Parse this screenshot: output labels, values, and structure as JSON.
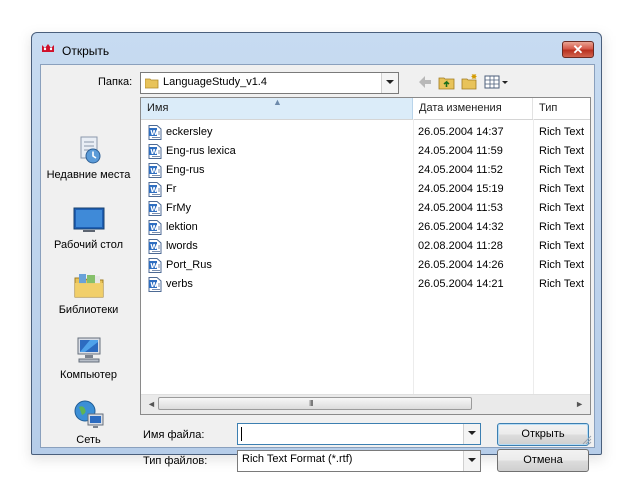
{
  "window": {
    "title": "Открыть",
    "close_glyph": "✕"
  },
  "toolbar": {
    "folder_label": "Папка:",
    "folder_value": "LanguageStudy_v1.4"
  },
  "places": [
    {
      "label": "Недавние места",
      "icon": "recent-places-icon"
    },
    {
      "label": "Рабочий стол",
      "icon": "desktop-icon"
    },
    {
      "label": "Библиотеки",
      "icon": "libraries-icon"
    },
    {
      "label": "Компьютер",
      "icon": "computer-icon"
    },
    {
      "label": "Сеть",
      "icon": "network-icon"
    }
  ],
  "list": {
    "columns": {
      "name": "Имя",
      "date": "Дата изменения",
      "type": "Тип"
    },
    "sort_glyph": "▲",
    "rows": [
      {
        "name": "eckersley",
        "date": "26.05.2004 14:37",
        "type": "Rich Text"
      },
      {
        "name": "Eng-rus lexica",
        "date": "24.05.2004 11:59",
        "type": "Rich Text"
      },
      {
        "name": "Eng-rus",
        "date": "24.05.2004 11:52",
        "type": "Rich Text"
      },
      {
        "name": "Fr",
        "date": "24.05.2004 15:19",
        "type": "Rich Text"
      },
      {
        "name": "FrMy",
        "date": "24.05.2004 11:53",
        "type": "Rich Text"
      },
      {
        "name": "lektion",
        "date": "26.05.2004 14:32",
        "type": "Rich Text"
      },
      {
        "name": "lwords",
        "date": "02.08.2004 11:28",
        "type": "Rich Text"
      },
      {
        "name": "Port_Rus",
        "date": "26.05.2004 14:26",
        "type": "Rich Text"
      },
      {
        "name": "verbs",
        "date": "26.05.2004 14:21",
        "type": "Rich Text"
      }
    ],
    "scroll_left": "◄",
    "scroll_right": "►",
    "scroll_grip": "III"
  },
  "form": {
    "filename_label": "Имя файла:",
    "filename_value": "",
    "filetype_label": "Тип файлов:",
    "filetype_value": "Rich Text Format (*.rtf)",
    "open_button": "Открыть",
    "cancel_button": "Отмена"
  },
  "colors": {
    "title_bar": "#c7dbf1",
    "close_button": "#c8402f",
    "sorted_header": "#dbecf9"
  }
}
